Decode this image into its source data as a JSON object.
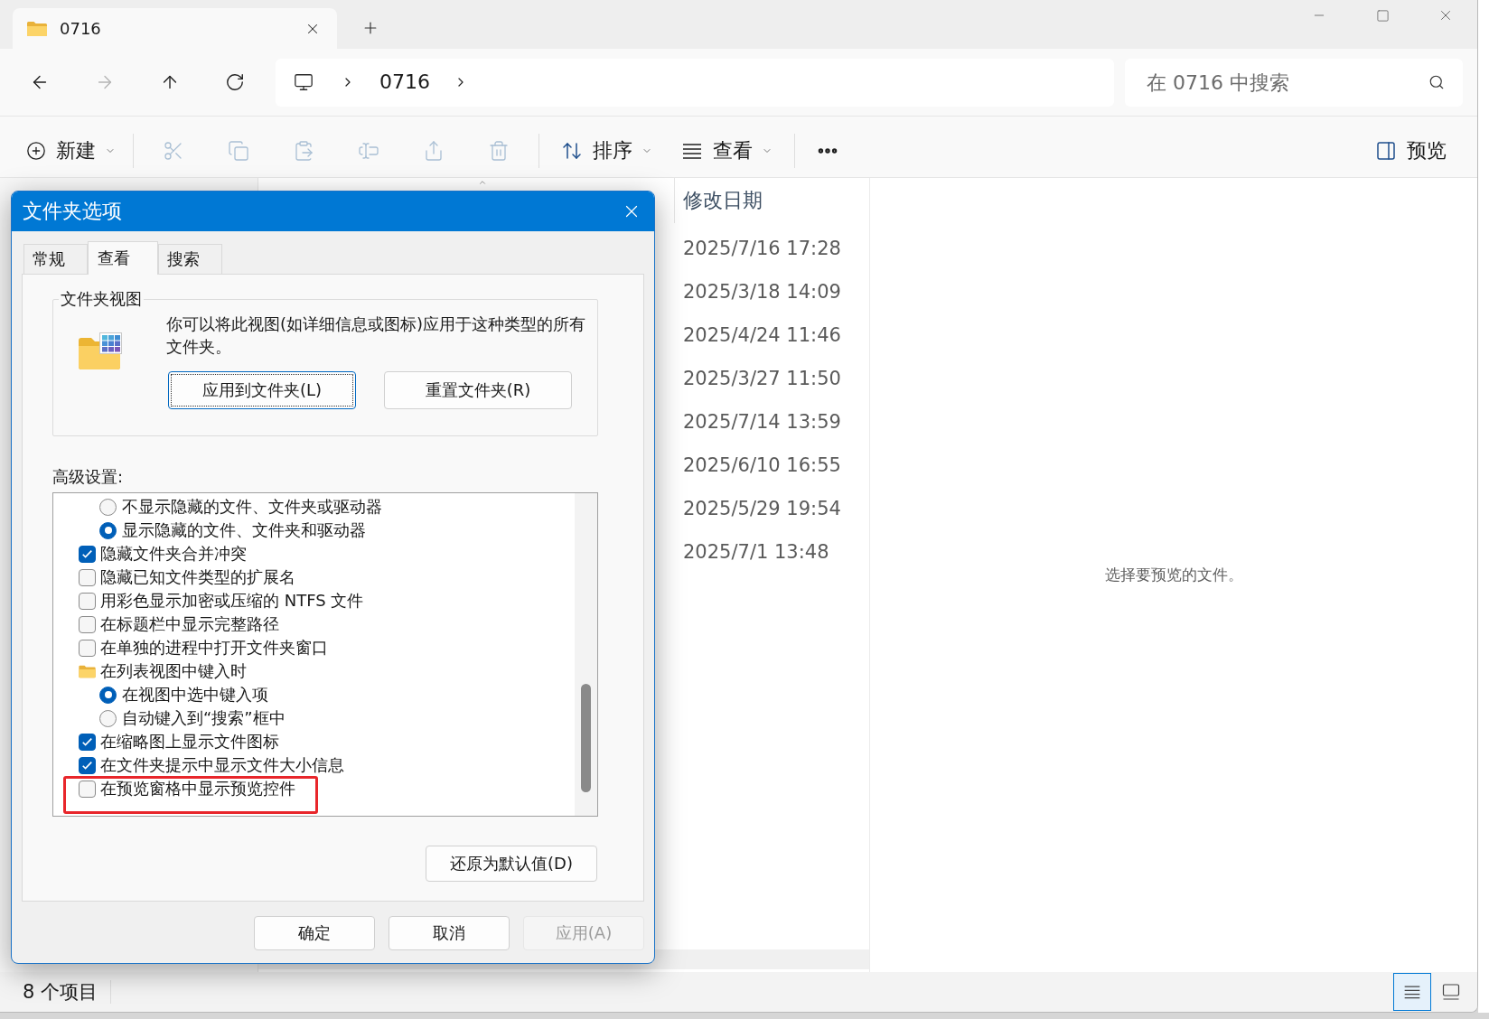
{
  "explorer": {
    "tabs": [
      {
        "label": "0716",
        "selected": true
      }
    ],
    "nav_buttons": [
      {
        "kind": "back",
        "disabled": false
      },
      {
        "kind": "forward",
        "disabled": true
      },
      {
        "kind": "up",
        "disabled": false
      },
      {
        "kind": "refresh",
        "disabled": false
      }
    ],
    "address_bar": {
      "path": [
        "0716"
      ]
    },
    "search": {
      "placeholder": "在 0716 中搜索"
    },
    "toolbar": {
      "groups": [
        [
          {
            "kind": "new",
            "label": "新建",
            "disabled": false,
            "dropdown": true
          }
        ],
        [
          {
            "kind": "cut",
            "disabled": true
          },
          {
            "kind": "copy",
            "disabled": true
          },
          {
            "kind": "paste",
            "disabled": true
          },
          {
            "kind": "rename",
            "disabled": true
          },
          {
            "kind": "share",
            "disabled": true
          },
          {
            "kind": "delete",
            "disabled": true
          }
        ],
        [
          {
            "kind": "sort",
            "label": "排序",
            "disabled": false,
            "dropdown": true
          },
          {
            "kind": "view",
            "label": "查看",
            "disabled": false,
            "dropdown": true
          }
        ],
        [
          {
            "kind": "more",
            "disabled": false
          }
        ]
      ],
      "right": [
        {
          "kind": "preview",
          "label": "预览",
          "disabled": false,
          "dropdown": false
        }
      ]
    },
    "file_list": {
      "columns": [
        "修改日期"
      ],
      "rows": [
        {
          "modified": "2025/7/16 17:28"
        },
        {
          "modified": "2025/3/18 14:09"
        },
        {
          "modified": "2025/4/24 11:46"
        },
        {
          "modified": "2025/3/27 11:50"
        },
        {
          "modified": "2025/7/14 13:59"
        },
        {
          "modified": "2025/6/10 16:55"
        },
        {
          "modified": "2025/5/29 19:54"
        },
        {
          "modified": "2025/7/1 13:48"
        }
      ]
    },
    "preview_pane": {
      "message": "选择要预览的文件。"
    },
    "status_bar": {
      "item_count": "8 个项目",
      "view_buttons": [
        {
          "kind": "details",
          "selected": true
        },
        {
          "kind": "tiles",
          "selected": false
        }
      ]
    }
  },
  "dialog": {
    "title": "文件夹选项",
    "tabs": [
      {
        "label": "常规",
        "selected": false
      },
      {
        "label": "查看",
        "selected": true
      },
      {
        "label": "搜索",
        "selected": false
      }
    ],
    "folder_views": {
      "title": "文件夹视图",
      "description": "你可以将此视图(如详细信息或图标)应用于这种类型的所有文件夹。",
      "buttons": [
        {
          "label": "应用到文件夹(L)",
          "focused": true
        },
        {
          "label": "重置文件夹(R)",
          "focused": false
        }
      ]
    },
    "advanced": {
      "label": "高级设置:",
      "items": [
        {
          "kind": "group",
          "children": [
            {
              "kind": "radio",
              "label": "不显示隐藏的文件、文件夹或驱动器",
              "selected": false,
              "highlighted": false
            },
            {
              "kind": "radio",
              "label": "显示隐藏的文件、文件夹和驱动器",
              "selected": true,
              "highlighted": false
            }
          ]
        },
        {
          "kind": "checkbox",
          "label": "隐藏文件夹合并冲突",
          "checked": true,
          "highlighted": false
        },
        {
          "kind": "checkbox",
          "label": "隐藏已知文件类型的扩展名",
          "checked": false,
          "highlighted": false
        },
        {
          "kind": "checkbox",
          "label": "用彩色显示加密或压缩的 NTFS 文件",
          "checked": false,
          "highlighted": false
        },
        {
          "kind": "checkbox",
          "label": "在标题栏中显示完整路径",
          "checked": false,
          "highlighted": false
        },
        {
          "kind": "checkbox",
          "label": "在单独的进程中打开文件夹窗口",
          "checked": false,
          "highlighted": false
        },
        {
          "kind": "folder",
          "label": "在列表视图中键入时",
          "highlighted": false,
          "children": [
            {
              "kind": "radio",
              "label": "在视图中选中键入项",
              "selected": true,
              "highlighted": false
            },
            {
              "kind": "radio",
              "label": "自动键入到“搜索”框中",
              "selected": false,
              "highlighted": false
            }
          ]
        },
        {
          "kind": "checkbox",
          "label": "在缩略图上显示文件图标",
          "checked": true,
          "highlighted": false
        },
        {
          "kind": "checkbox",
          "label": "在文件夹提示中显示文件大小信息",
          "checked": true,
          "highlighted": false
        },
        {
          "kind": "checkbox",
          "label": "在预览窗格中显示预览控件",
          "checked": false,
          "highlighted": true
        }
      ]
    },
    "restore_button": {
      "label": "还原为默认值(D)"
    },
    "buttons": [
      {
        "label": "确定",
        "disabled": false
      },
      {
        "label": "取消",
        "disabled": false
      },
      {
        "label": "应用(A)",
        "disabled": true
      }
    ]
  }
}
